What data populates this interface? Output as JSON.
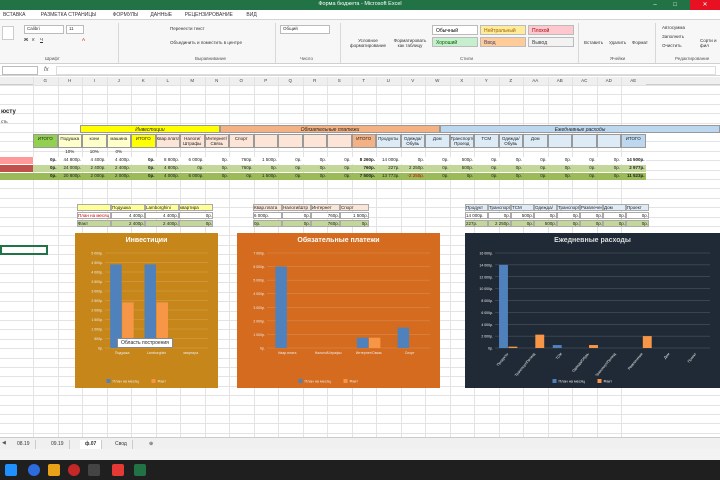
{
  "window": {
    "title": "Форма бюджета - Microsoft Excel"
  },
  "ribbon_tabs": [
    "ВСТАВКА",
    "РАЗМЕТКА СТРАНИЦЫ",
    "ФОРМУЛЫ",
    "ДАННЫЕ",
    "РЕЦЕНЗИРОВАНИЕ",
    "ВИД"
  ],
  "ribbon": {
    "font": "Calibri",
    "size": "11",
    "wrap": "Перенести текст",
    "merge": "Объединить и поместить в центре",
    "numfmt": "Общий",
    "cond": "Условное форматирование",
    "table": "Форматировать как таблицу",
    "insert": "Вставить",
    "delete": "Удалить",
    "format": "Формат",
    "autosum": "Автосумма",
    "fill": "Заполнить",
    "clear": "Очистить",
    "sort": "Сорти и фил",
    "styles": [
      {
        "label": "Обычный",
        "bg": "#ffffff",
        "fg": "#000000"
      },
      {
        "label": "Нейтральный",
        "bg": "#ffeb9c",
        "fg": "#9c6500"
      },
      {
        "label": "Плохой",
        "bg": "#ffc7ce",
        "fg": "#9c0006"
      },
      {
        "label": "Хороший",
        "bg": "#c6efce",
        "fg": "#006100"
      },
      {
        "label": "Ввод",
        "bg": "#ffcc99",
        "fg": "#3f3f76"
      },
      {
        "label": "Вывод",
        "bg": "#f2f2f2",
        "fg": "#3f3f3f"
      }
    ],
    "groups": [
      "Шрифт",
      "Выравнивание",
      "Число",
      "Стили",
      "Ячейки",
      "Редактирование"
    ]
  },
  "formula_bar": {
    "name": "",
    "fx": "fx"
  },
  "columns": [
    "G",
    "H",
    "I",
    "J",
    "K",
    "L",
    "M",
    "N",
    "O",
    "P",
    "Q",
    "R",
    "S",
    "T",
    "U",
    "V",
    "W",
    "X",
    "Y",
    "Z",
    "AA",
    "AB",
    "AC",
    "AD",
    "AE"
  ],
  "sheet": {
    "title": "юсту",
    "subtitle": "сть",
    "sections": {
      "inv": "Инвестиции",
      "mand": "Обязательные платежи",
      "daily": "Ежедневные расходы"
    },
    "hdr": [
      "ИТОГО",
      "Подушка",
      "кони",
      "машина",
      "ИТОГО",
      "Квар.плата",
      "Налоги/Штрафы",
      "Интернет/Связь",
      "Спорт",
      "",
      "",
      "",
      "",
      "ИТОГО",
      "Продукты",
      "Одежда/Обувь",
      "Дом",
      "Транспорт/Проезд",
      "ТСМ",
      "Одежда/Обувь",
      "Дом",
      "",
      "",
      "",
      "ИТОГО"
    ],
    "pct": [
      "10%",
      "10%",
      "0%"
    ],
    "rows": [
      {
        "lbl": "",
        "bg": "#ffffff",
        "vals": [
          "0р.",
          "44 800р.",
          "4 400р.",
          "4 400р.",
          "0р.",
          "8 800р.",
          "6 000р.",
          "0р.",
          "760р.",
          "1 500р.",
          "0р.",
          "0р.",
          "0р.",
          "8 260р.",
          "14 000р.",
          "0р.",
          "0р.",
          "500р.",
          "0р.",
          "0р.",
          "0р.",
          "0р.",
          "0р.",
          "0р.",
          "14 500р."
        ]
      },
      {
        "lbl": "",
        "bg": "#c4d79b",
        "vals": [
          "0р.",
          "24 000р.",
          "2 400р.",
          "2 400р.",
          "0р.",
          "4 800р.",
          "0р.",
          "0р.",
          "760р.",
          "0р.",
          "0р.",
          "0р.",
          "0р.",
          "760р.",
          "227р.",
          "2 250р.",
          "0р.",
          "500р.",
          "0р.",
          "0р.",
          "0р.",
          "0р.",
          "0р.",
          "0р.",
          "2 977р."
        ]
      },
      {
        "lbl": "",
        "bg": "#9bbb59",
        "vals": [
          "0р.",
          "20 800р.",
          "2 000р.",
          "2 000р.",
          "0р.",
          "4 000р.",
          "6 000р.",
          "0р.",
          "0р.",
          "1 500р.",
          "0р.",
          "0р.",
          "0р.",
          "7 500р.",
          "13 773р.",
          "-2 250р.",
          "0р.",
          "0р.",
          "0р.",
          "0р.",
          "0р.",
          "0р.",
          "0р.",
          "0р.",
          "11 523р."
        ]
      }
    ],
    "mini_inv": {
      "head": [
        "",
        "Подушка",
        "Lamborghini",
        "квартира"
      ],
      "r1": [
        "План на месяц",
        "4 400р.",
        "4 400р.",
        "0р."
      ],
      "r2": [
        "Факт",
        "2 400р.",
        "2 400р.",
        "0р."
      ]
    },
    "mini_mand": {
      "head": [
        "Квар.плата",
        "Налоги/Штр",
        "Интернет",
        "Спорт"
      ],
      "r1": [
        "6 000р.",
        "0р.",
        "760р.",
        "1 500р."
      ],
      "r2": [
        "0р.",
        "0р.",
        "760р.",
        "0р."
      ]
    },
    "mini_daily": {
      "head": [
        "Продукт",
        "Транспорт",
        "ТСМ",
        "Одежда/",
        "Транспорт",
        "Развлечен",
        "Дом",
        "Проект"
      ],
      "r1": [
        "14 000р.",
        "0р.",
        "500р.",
        "0р.",
        "0р.",
        "0р.",
        "0р.",
        "0р."
      ],
      "r2": [
        "227р.",
        "2 250р.",
        "0р.",
        "500р.",
        "0р.",
        "0р.",
        "0р.",
        "0р."
      ]
    }
  },
  "chart_data": [
    {
      "type": "bar",
      "title": "Инвестиции",
      "categories": [
        "Подушка",
        "Lamborghini",
        "квартира"
      ],
      "series": [
        {
          "name": "План на месяц",
          "values": [
            4400,
            4400,
            0
          ]
        },
        {
          "name": "Факт",
          "values": [
            2400,
            2400,
            0
          ]
        }
      ],
      "ylim": [
        0,
        5000
      ],
      "ticks": [
        "0р.",
        "500р.",
        "1 000р.",
        "1 500р.",
        "2 000р.",
        "2 500р.",
        "3 000р.",
        "3 500р.",
        "4 000р.",
        "4 500р.",
        "5 000р."
      ],
      "tooltip": "Область построения",
      "bg": "#c6861a",
      "c1": "#4f81bd",
      "c2": "#f79646"
    },
    {
      "type": "bar",
      "title": "Обязательные платежи",
      "categories": [
        "Квар.плата",
        "Налоги/Штрафы",
        "Интернет/Связь",
        "Спорт"
      ],
      "series": [
        {
          "name": "План на месяц",
          "values": [
            6000,
            0,
            760,
            1500
          ]
        },
        {
          "name": "Факт",
          "values": [
            0,
            0,
            760,
            0
          ]
        }
      ],
      "ylim": [
        0,
        7000
      ],
      "ticks": [
        "0р.",
        "1 000р.",
        "2 000р.",
        "3 000р.",
        "4 000р.",
        "5 000р.",
        "6 000р.",
        "7 000р."
      ],
      "bg": "#d46b1e",
      "c1": "#4f81bd",
      "c2": "#f79646"
    },
    {
      "type": "bar",
      "title": "Ежедневные расходы",
      "categories": [
        "Продукты",
        "Транспорт/Проезд",
        "ТСМ",
        "Одежда/Обувь",
        "Транспорт/Проезд",
        "Развлечения",
        "Дом",
        "Проект"
      ],
      "series": [
        {
          "name": "План на месяц",
          "values": [
            14000,
            0,
            500,
            0,
            0,
            0,
            0,
            0
          ]
        },
        {
          "name": "Факт",
          "values": [
            227,
            2250,
            0,
            500,
            0,
            2000,
            0,
            0
          ]
        }
      ],
      "ylim": [
        0,
        16000
      ],
      "ticks": [
        "0р.",
        "2 000р.",
        "4 000р.",
        "6 000р.",
        "8 000р.",
        "10 000р.",
        "12 000р.",
        "14 000р.",
        "16 000р."
      ],
      "bg": "#1f2a36",
      "c1": "#4f81bd",
      "c2": "#f79646"
    }
  ],
  "sheet_tabs": [
    "08.19",
    "09.19",
    "ф.07",
    "Свод"
  ]
}
